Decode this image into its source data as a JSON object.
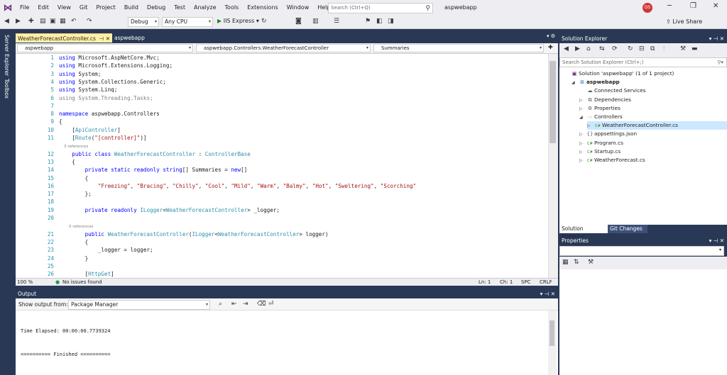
{
  "menu": [
    "File",
    "Edit",
    "View",
    "Git",
    "Project",
    "Build",
    "Debug",
    "Test",
    "Analyze",
    "Tools",
    "Extensions",
    "Window",
    "Help"
  ],
  "search_placeholder": "Search (Ctrl+Q)",
  "solution_title": "aspwebapp",
  "avatar_initials": "DS",
  "toolbar": {
    "config": "Debug",
    "platform": "Any CPU",
    "run_label": "IIS Express",
    "live_share": "Live Share"
  },
  "left_rail": [
    "Server Explorer",
    "Toolbox"
  ],
  "tabs": {
    "active": "WeatherForecastController.cs",
    "inactive": "aspwebapp"
  },
  "navbar": {
    "project": "aspwebapp",
    "class": "aspwebapp.Controllers.WeatherForecastController",
    "member": "Summaries"
  },
  "code_lines": [
    {
      "n": "1",
      "t": "using Microsoft.AspNetCore.Mvc;"
    },
    {
      "n": "2",
      "t": "using Microsoft.Extensions.Logging;"
    },
    {
      "n": "3",
      "t": "using System;"
    },
    {
      "n": "4",
      "t": "using System.Collections.Generic;"
    },
    {
      "n": "5",
      "t": "using System.Linq;"
    },
    {
      "n": "6",
      "t": "using System.Threading.Tasks;"
    },
    {
      "n": "7",
      "t": ""
    },
    {
      "n": "8",
      "t": "namespace aspwebapp.Controllers"
    },
    {
      "n": "9",
      "t": "{"
    },
    {
      "n": "10",
      "t": "    [ApiController]"
    },
    {
      "n": "11",
      "t": "    [Route(\"[controller]\")]"
    },
    {
      "n": "",
      "t": "    3 references"
    },
    {
      "n": "12",
      "t": "    public class WeatherForecastController : ControllerBase"
    },
    {
      "n": "13",
      "t": "    {"
    },
    {
      "n": "14",
      "t": "        private static readonly string[] Summaries = new[]"
    },
    {
      "n": "15",
      "t": "        {"
    },
    {
      "n": "16",
      "t": "            \"Freezing\", \"Bracing\", \"Chilly\", \"Cool\", \"Mild\", \"Warm\", \"Balmy\", \"Hot\", \"Sweltering\", \"Scorching\""
    },
    {
      "n": "17",
      "t": "        };"
    },
    {
      "n": "18",
      "t": ""
    },
    {
      "n": "19",
      "t": "        private readonly ILogger<WeatherForecastController> _logger;"
    },
    {
      "n": "20",
      "t": ""
    },
    {
      "n": "",
      "t": "        0 references"
    },
    {
      "n": "21",
      "t": "        public WeatherForecastController(ILogger<WeatherForecastController> logger)"
    },
    {
      "n": "22",
      "t": "        {"
    },
    {
      "n": "23",
      "t": "            _logger = logger;"
    },
    {
      "n": "24",
      "t": "        }"
    },
    {
      "n": "25",
      "t": ""
    },
    {
      "n": "26",
      "t": "        [HttpGet]"
    }
  ],
  "editor_status": {
    "zoom": "100 %",
    "issues": "No issues found",
    "line": "Ln: 1",
    "col": "Ch: 1",
    "spc": "SPC",
    "eol": "CRLF"
  },
  "output": {
    "title": "Output",
    "show_from_label": "Show output from:",
    "source": "Package Manager",
    "lines": [
      "Time Elapsed: 00:00:00.7739324",
      "========== Finished =========="
    ]
  },
  "solution_explorer": {
    "title": "Solution Explorer",
    "search_placeholder": "Search Solution Explorer (Ctrl+;)",
    "items": [
      {
        "label": "Solution 'aspwebapp' (1 of 1 project)",
        "indent": 0,
        "exp": "",
        "icon": "solution-icon"
      },
      {
        "label": "aspwebapp",
        "indent": 1,
        "exp": "◢",
        "icon": "project-icon"
      },
      {
        "label": "Connected Services",
        "indent": 2,
        "exp": "",
        "icon": "connected-services-icon"
      },
      {
        "label": "Dependencies",
        "indent": 2,
        "exp": "▷",
        "icon": "dependencies-icon"
      },
      {
        "label": "Properties",
        "indent": 2,
        "exp": "▷",
        "icon": "properties-icon"
      },
      {
        "label": "Controllers",
        "indent": 2,
        "exp": "◢",
        "icon": "folder-icon"
      },
      {
        "label": "WeatherForecastController.cs",
        "indent": 3,
        "exp": "▷",
        "icon": "csharp-file-icon"
      },
      {
        "label": "appsettings.json",
        "indent": 2,
        "exp": "▷",
        "icon": "json-file-icon"
      },
      {
        "label": "Program.cs",
        "indent": 2,
        "exp": "▷",
        "icon": "csharp-file-icon"
      },
      {
        "label": "Startup.cs",
        "indent": 2,
        "exp": "▷",
        "icon": "csharp-file-icon"
      },
      {
        "label": "WeatherForecast.cs",
        "indent": 2,
        "exp": "▷",
        "icon": "csharp-file-icon"
      }
    ],
    "tabs": [
      "Solution Explorer",
      "Git Changes"
    ]
  },
  "properties": {
    "title": "Properties"
  },
  "colors": {
    "chrome_dark": "#293955",
    "active_tab": "#fff1a8",
    "keyword": "#0000ff",
    "type": "#2b91af",
    "string": "#a31515"
  }
}
